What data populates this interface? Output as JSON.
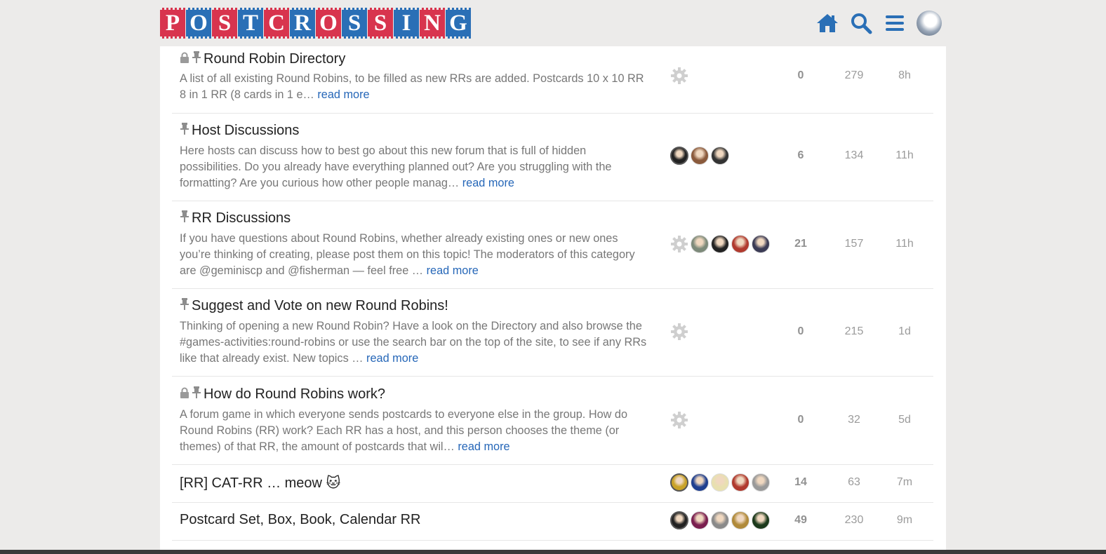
{
  "header": {
    "logo_letters": [
      "P",
      "O",
      "S",
      "T",
      "C",
      "R",
      "O",
      "S",
      "S",
      "I",
      "N",
      "G"
    ],
    "icons": [
      "home-icon",
      "search-icon",
      "hamburger-menu-icon",
      "user-avatar"
    ]
  },
  "topics": [
    {
      "title": "Round Robin Directory",
      "locked": true,
      "pinned": true,
      "excerpt": "A list of all existing Round Robins, to be filled as new RRs are added. Postcards 10 x 10 RR 8 in 1 RR (8 cards in 1 e…",
      "read_more": "read more",
      "posters": [
        "gear"
      ],
      "replies": "0",
      "views": "279",
      "activity": "8h"
    },
    {
      "title": "Host Discussions",
      "locked": false,
      "pinned": true,
      "excerpt": "Here hosts can discuss how to best go about this new forum that is full of hidden possibilities. Do you already have everything planned out? Are you struggling with the formatting? Are you curious how other people manag…",
      "read_more": "read more",
      "posters": [
        "#222",
        "#8a5a3c",
        "#333"
      ],
      "replies": "6",
      "views": "134",
      "activity": "11h"
    },
    {
      "title": "RR Discussions",
      "locked": false,
      "pinned": true,
      "excerpt": "If you have questions about Round Robins, whether already existing ones or new ones you’re thinking of creating, please post them on this topic! The moderators of this category are @geminiscp and @fisherman — feel free …",
      "read_more": "read more",
      "posters": [
        "gear",
        "#7d8a7a",
        "#222",
        "#b03a2e",
        "#3b3b55"
      ],
      "replies": "21",
      "views": "157",
      "activity": "11h"
    },
    {
      "title": "Suggest and Vote on new Round Robins!",
      "locked": false,
      "pinned": true,
      "excerpt": "Thinking of opening a new Round Robin? Have a look on the Directory and also browse the #games-activities:round-robins or use the search bar on the top of the site, to see if any RRs like that already exist. New topics …",
      "read_more": "read more",
      "posters": [
        "gear"
      ],
      "replies": "0",
      "views": "215",
      "activity": "1d"
    },
    {
      "title": "How do Round Robins work?",
      "locked": true,
      "pinned": true,
      "excerpt": "A forum game in which everyone sends postcards to everyone else in the group. How do Round Robins (RR) work? Each RR has a host, and this person chooses the theme (or themes) of that RR, the amount of postcards that wil…",
      "read_more": "read more",
      "posters": [
        "gear"
      ],
      "replies": "0",
      "views": "32",
      "activity": "5d"
    },
    {
      "title": "[RR] CAT-RR … meow 🐱",
      "locked": false,
      "pinned": false,
      "excerpt": "",
      "read_more": "",
      "posters": [
        "#c9a227",
        "#1f3f8f",
        "#e8e0b0",
        "#b03a2e",
        "#999"
      ],
      "replies": "14",
      "views": "63",
      "activity": "7m"
    },
    {
      "title": "Postcard Set, Box, Book, Calendar RR",
      "locked": false,
      "pinned": false,
      "excerpt": "",
      "read_more": "",
      "posters": [
        "#222",
        "#7a1f4f",
        "#8a8a8a",
        "#b08a3a",
        "#1c3a1c"
      ],
      "replies": "49",
      "views": "230",
      "activity": "9m"
    }
  ]
}
